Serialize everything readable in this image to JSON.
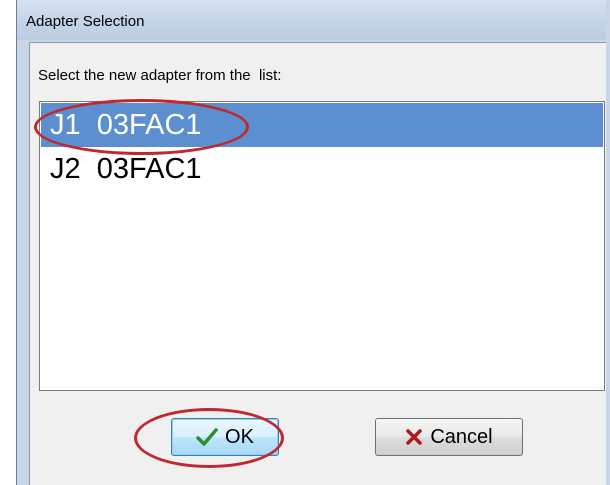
{
  "window": {
    "title": "Adapter Selection"
  },
  "dialog": {
    "prompt": "Select the new adapter from the  list:",
    "adapters": [
      {
        "label": "J1  03FAC1",
        "selected": true
      },
      {
        "label": "J2  03FAC1",
        "selected": false
      }
    ],
    "buttons": {
      "ok_label": "OK",
      "ok_icon": "checkmark-icon",
      "cancel_label": "Cancel",
      "cancel_icon": "x-icon"
    }
  },
  "colors": {
    "selection": "#5b8fcf",
    "annotation": "#c0282f",
    "ok_check": "#2e8b2e",
    "cancel_x": "#b01818"
  }
}
